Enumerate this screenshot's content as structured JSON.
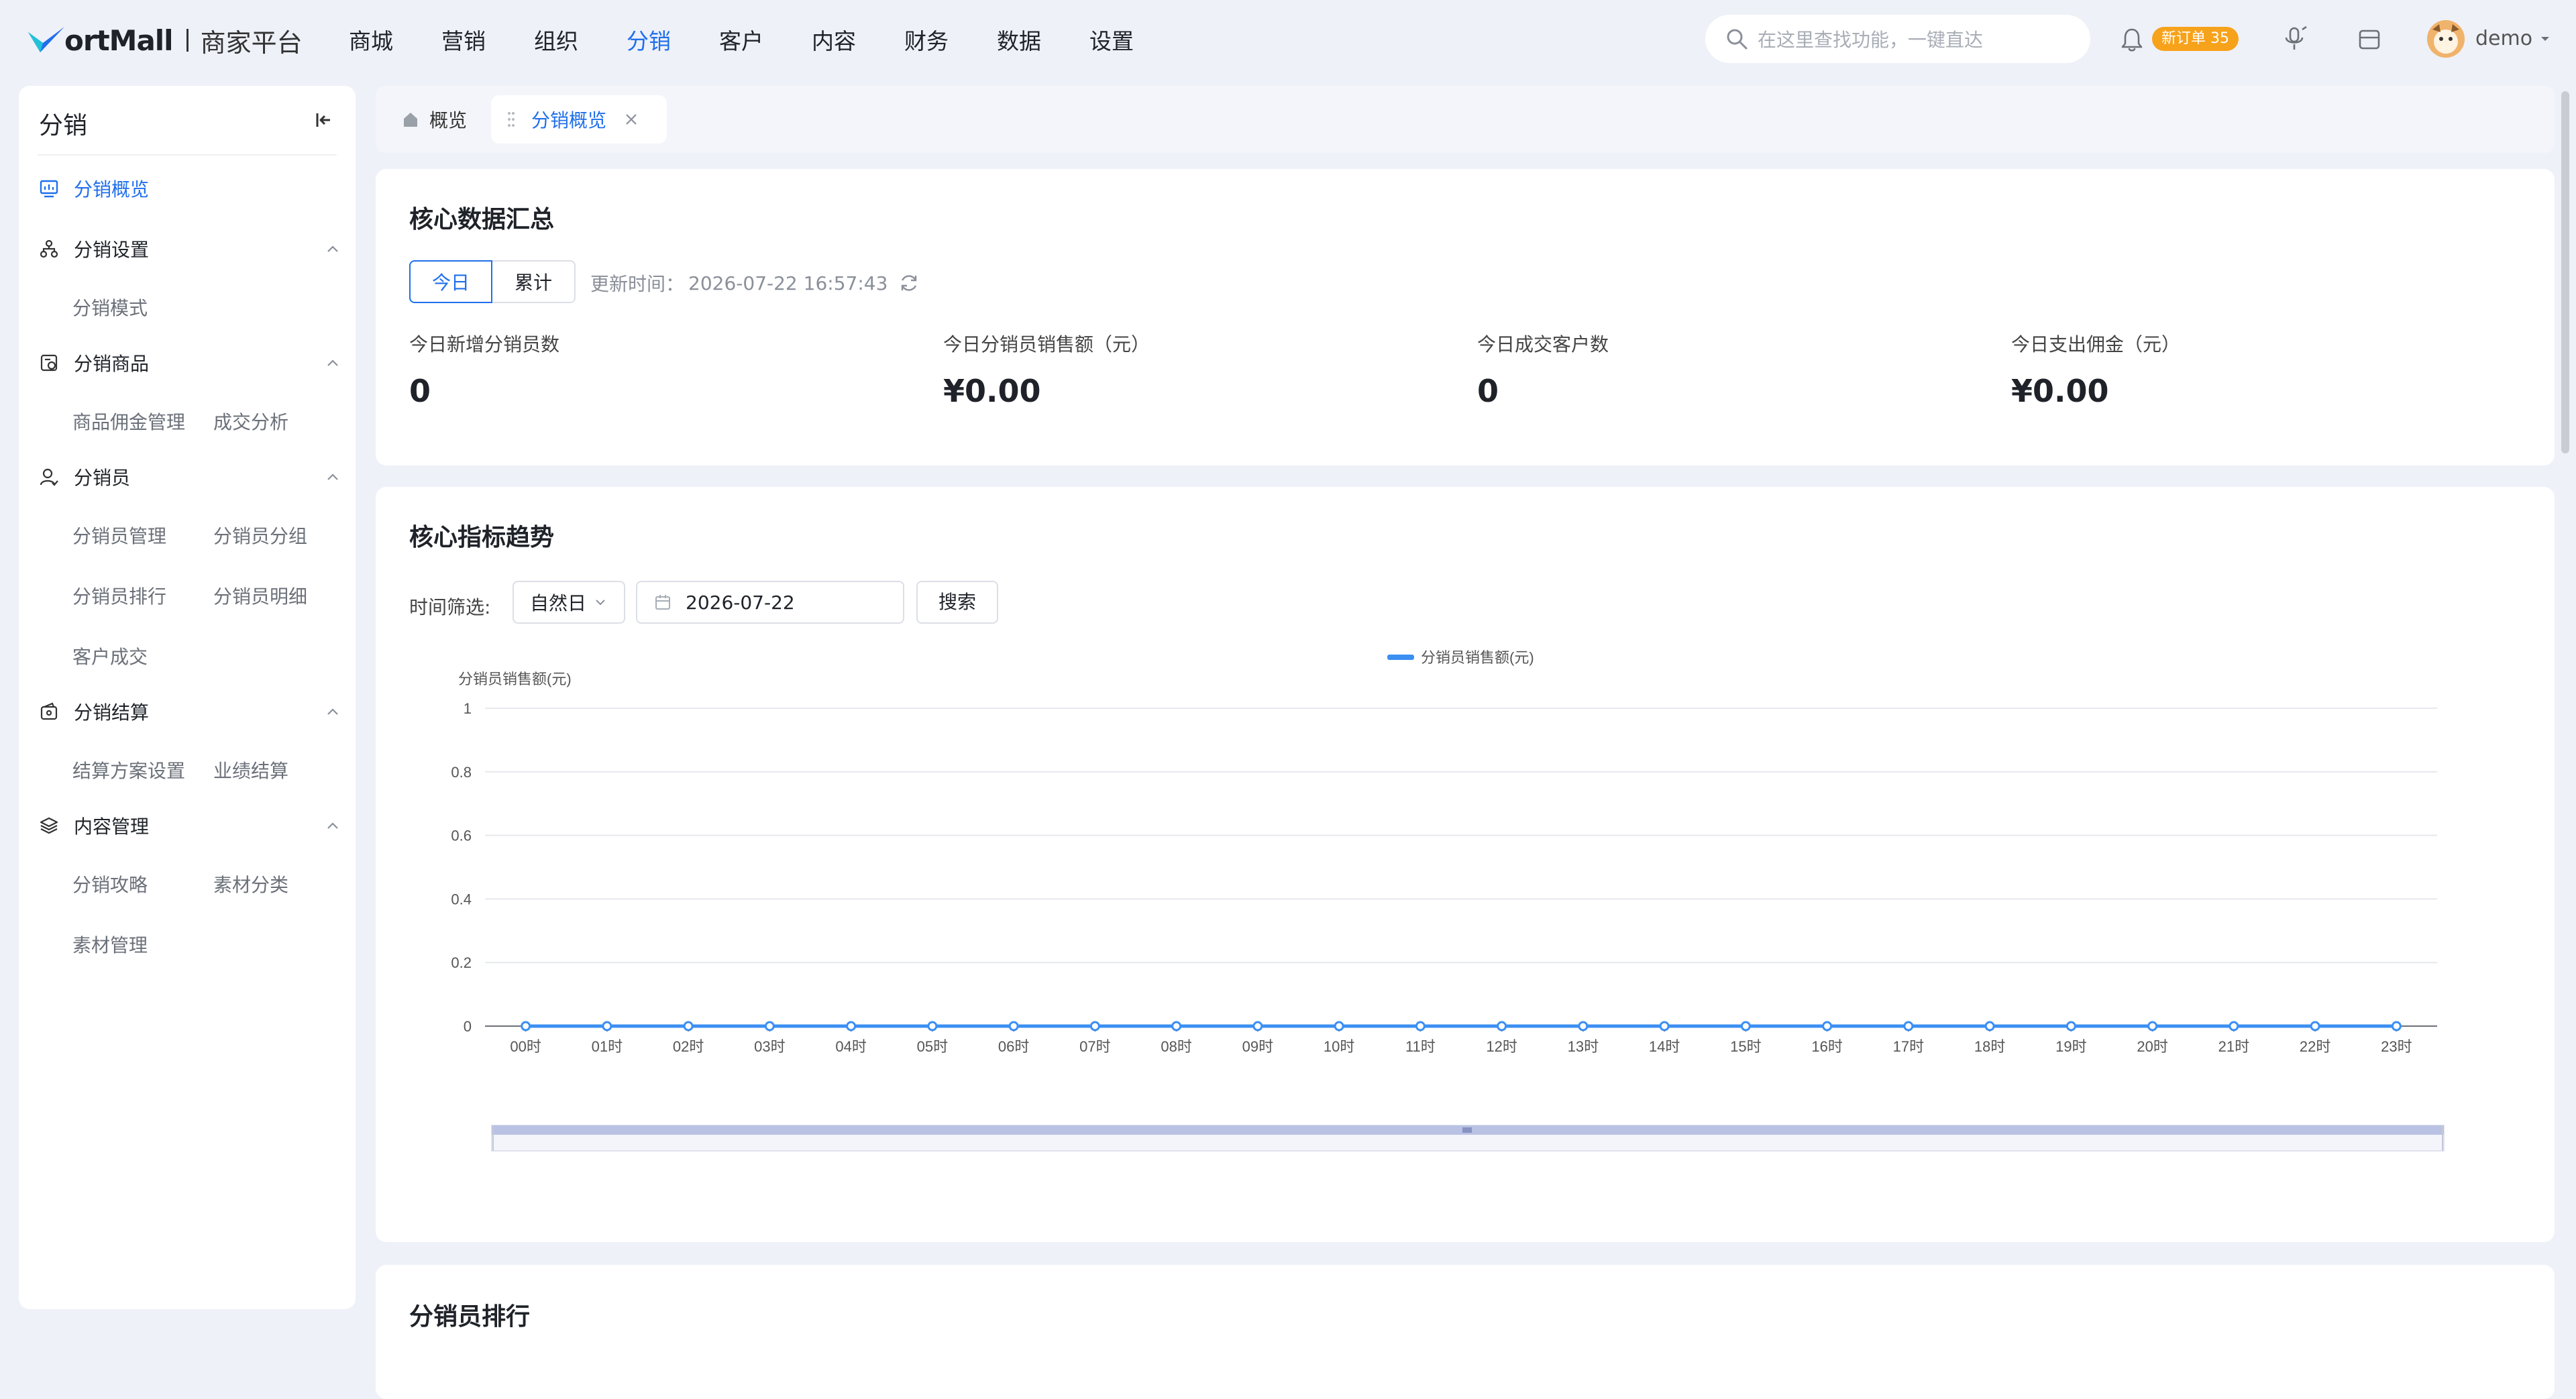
{
  "header": {
    "logo_text": "ortMall",
    "logo_sub": "商家平台",
    "nav": [
      "商城",
      "营销",
      "组织",
      "分销",
      "客户",
      "内容",
      "财务",
      "数据",
      "设置"
    ],
    "nav_active": "分销",
    "search_placeholder": "在这里查找功能，一键直达",
    "badge": "新订单 35",
    "username": "demo"
  },
  "sidebar": {
    "title": "分销",
    "groups": [
      {
        "label": "分销概览",
        "icon": "chart-board-icon",
        "active": true
      },
      {
        "label": "分销设置",
        "icon": "org-tree-icon",
        "subs": [
          "分销模式"
        ]
      },
      {
        "label": "分销商品",
        "icon": "goods-icon",
        "subs": [
          "商品佣金管理",
          "成交分析"
        ]
      },
      {
        "label": "分销员",
        "icon": "person-icon",
        "subs": [
          "分销员管理",
          "分销员分组",
          "分销员排行",
          "分销员明细",
          "客户成交"
        ]
      },
      {
        "label": "分销结算",
        "icon": "wallet-icon",
        "subs": [
          "结算方案设置",
          "业绩结算"
        ]
      },
      {
        "label": "内容管理",
        "icon": "layers-icon",
        "subs": [
          "分销攻略",
          "素材分类",
          "素材管理"
        ]
      }
    ]
  },
  "tabs": {
    "home": "概览",
    "current": "分销概览"
  },
  "summary": {
    "title": "核心数据汇总",
    "seg_today": "今日",
    "seg_total": "累计",
    "updated_label": "更新时间：",
    "updated_value": "2026-07-22 16:57:43",
    "stats": [
      {
        "label": "今日新增分销员数",
        "value": "0"
      },
      {
        "label": "今日分销员销售额（元）",
        "value": "¥0.00"
      },
      {
        "label": "今日成交客户数",
        "value": "0"
      },
      {
        "label": "今日支出佣金（元）",
        "value": "¥0.00"
      }
    ]
  },
  "trend": {
    "title": "核心指标趋势",
    "filter_label": "时间筛选:",
    "period": "自然日",
    "date": "2026-07-22",
    "search_button": "搜索"
  },
  "ranking": {
    "title": "分销员排行"
  },
  "chart_data": {
    "type": "line",
    "legend_position": "top-center",
    "series": [
      {
        "name": "分销员销售额(元)",
        "color": "#3b8ff3",
        "values": [
          0,
          0,
          0,
          0,
          0,
          0,
          0,
          0,
          0,
          0,
          0,
          0,
          0,
          0,
          0,
          0,
          0,
          0,
          0,
          0,
          0,
          0,
          0,
          0
        ]
      }
    ],
    "ylabel": "分销员销售额(元)",
    "ylim": [
      0,
      1
    ],
    "yticks": [
      0,
      0.2,
      0.4,
      0.6,
      0.8,
      1
    ],
    "categories": [
      "00时",
      "01时",
      "02时",
      "03时",
      "04时",
      "05时",
      "06时",
      "07时",
      "08时",
      "09时",
      "10时",
      "11时",
      "12时",
      "13时",
      "14时",
      "15时",
      "16时",
      "17时",
      "18时",
      "19时",
      "20时",
      "21时",
      "22时",
      "23时"
    ],
    "grid": true,
    "has_datazoom": true
  }
}
